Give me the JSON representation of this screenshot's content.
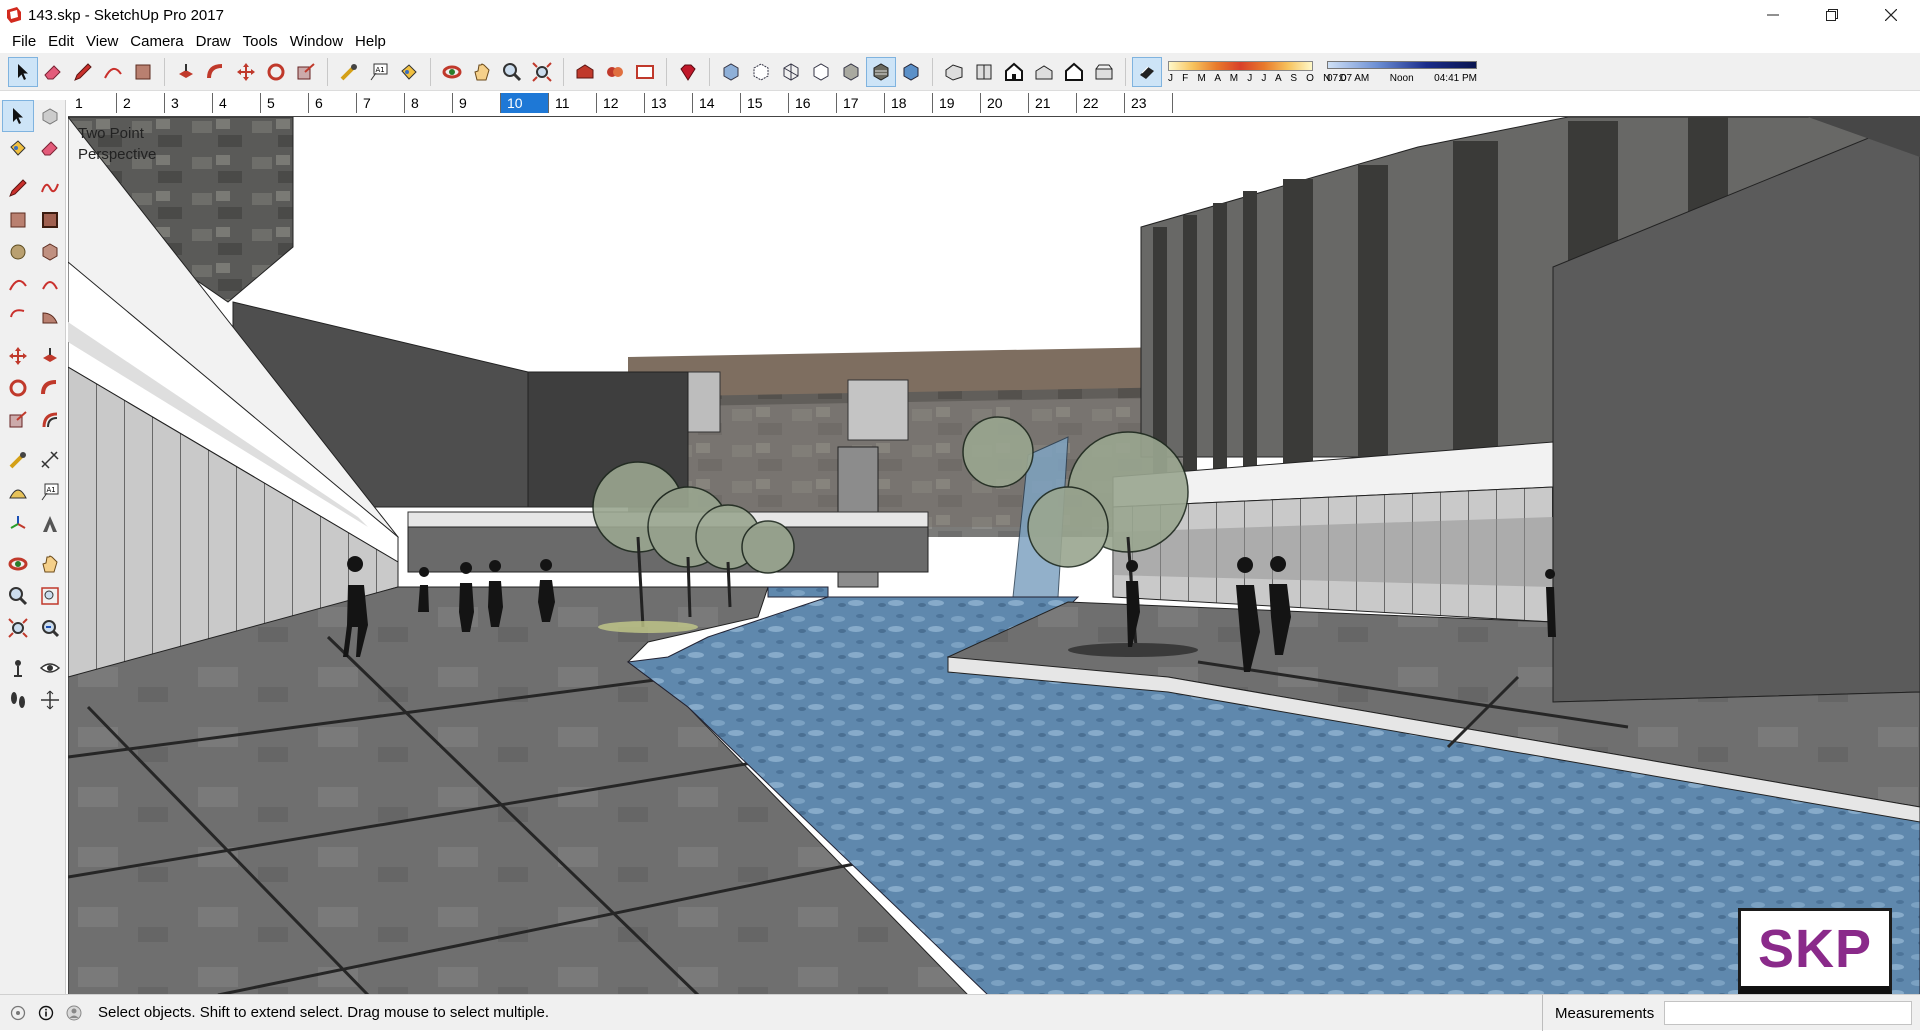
{
  "window": {
    "title": "143.skp - SketchUp Pro 2017",
    "minimize_icon": "minimize-icon",
    "maximize_icon": "restore-icon",
    "close_icon": "close-icon"
  },
  "menu": {
    "items": [
      "File",
      "Edit",
      "View",
      "Camera",
      "Draw",
      "Tools",
      "Window",
      "Help"
    ]
  },
  "toolbar": {
    "tools": [
      "select",
      "eraser",
      "line",
      "arc",
      "rectangle",
      "push-pull",
      "follow-me",
      "move",
      "rotate",
      "scale",
      "tape-measure",
      "text",
      "paint-bucket",
      "orbit",
      "pan",
      "zoom",
      "zoom-extents",
      "3d-warehouse",
      "extension-warehouse",
      "layout",
      "ruby-console",
      "xray",
      "back-edges",
      "wireframe",
      "hidden-line",
      "shaded",
      "shaded-textures",
      "monochrome",
      "iso",
      "top",
      "front",
      "right",
      "back",
      "left",
      "shadows"
    ],
    "active_tool": "shaded-textures",
    "shadow_months": "J F M A M J J A S O N D",
    "shadow_time_start": "07:07 AM",
    "shadow_time_mid": "Noon",
    "shadow_time_end": "04:41 PM"
  },
  "scenes": {
    "tabs": [
      "1",
      "2",
      "3",
      "4",
      "5",
      "6",
      "7",
      "8",
      "9",
      "10",
      "11",
      "12",
      "13",
      "14",
      "15",
      "16",
      "17",
      "18",
      "19",
      "20",
      "21",
      "22",
      "23"
    ],
    "active": "10"
  },
  "viewport": {
    "camera_line1": "Two Point",
    "camera_line2": "Perspective",
    "badge": "SKP"
  },
  "status": {
    "message": "Select objects. Shift to extend select. Drag mouse to select multiple.",
    "measurements_label": "Measurements",
    "measurements_value": ""
  },
  "colors": {
    "accent": "#1e78d6",
    "water": "#5c86ab",
    "pavement": "#6e6e6e",
    "badge_text": "#8a2a8a"
  }
}
